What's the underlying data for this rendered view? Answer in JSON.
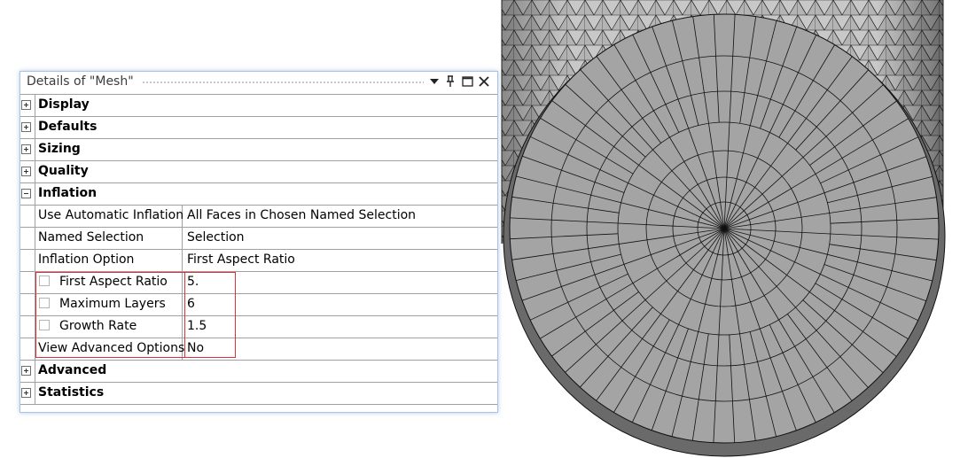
{
  "panel": {
    "title": "Details of \"Mesh\"",
    "icons": [
      "dropdown-arrow-icon",
      "pin-icon",
      "maximize-icon",
      "close-icon"
    ]
  },
  "categories": [
    {
      "label": "Display",
      "expanded": false
    },
    {
      "label": "Defaults",
      "expanded": false
    },
    {
      "label": "Sizing",
      "expanded": false
    },
    {
      "label": "Quality",
      "expanded": false
    },
    {
      "label": "Inflation",
      "expanded": true,
      "properties": [
        {
          "name": "Use Automatic Inflation",
          "value": "All Faces in Chosen Named Selection"
        },
        {
          "name": "Named Selection",
          "value": "Selection"
        },
        {
          "name": "Inflation Option",
          "value": "First Aspect Ratio"
        },
        {
          "name": "First Aspect Ratio",
          "value": "5."
        },
        {
          "name": "Maximum Layers",
          "value": "6"
        },
        {
          "name": "Growth Rate",
          "value": "1.5"
        },
        {
          "name": "View Advanced Options",
          "value": "No"
        }
      ]
    },
    {
      "label": "Advanced",
      "expanded": false
    },
    {
      "label": "Statistics",
      "expanded": false
    }
  ],
  "colors": {
    "highlight_box": "#d9343a",
    "grid_line": "#a0a0a0",
    "mesh_face": "#a4a4a4",
    "mesh_edge": "#111111",
    "panel_border": "#a9c3e6"
  }
}
